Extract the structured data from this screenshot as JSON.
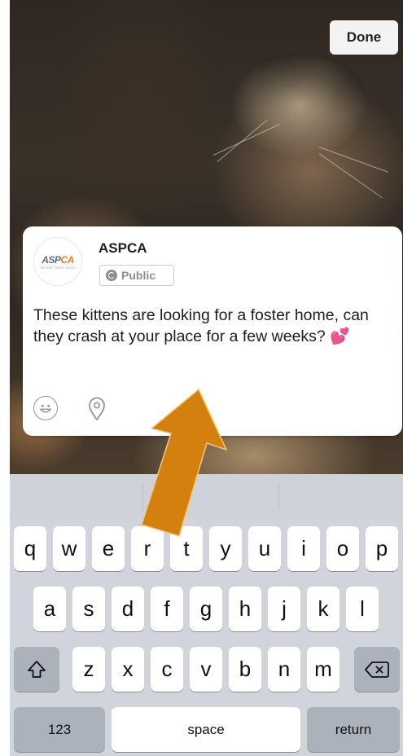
{
  "header": {
    "done_label": "Done"
  },
  "post": {
    "page_name": "ASPCA",
    "avatar_logo_a": "ASP",
    "avatar_logo_b": "CA",
    "avatar_tagline": "WE ARE THEIR VOICE",
    "privacy_label": "Public",
    "text": "These kittens are looking for a foster home, can they crash at your place for a few weeks?",
    "emoji": "💕",
    "tools": [
      "emoji-icon",
      "location-pin-icon"
    ]
  },
  "keyboard": {
    "row1": [
      "q",
      "w",
      "e",
      "r",
      "t",
      "y",
      "u",
      "i",
      "o",
      "p"
    ],
    "row2": [
      "a",
      "s",
      "d",
      "f",
      "g",
      "h",
      "j",
      "k",
      "l"
    ],
    "row3": [
      "z",
      "x",
      "c",
      "v",
      "b",
      "n",
      "m"
    ],
    "shift_icon": "shift-icon",
    "delete_icon": "backspace-icon",
    "numbers_label": "123",
    "space_label": "space",
    "return_label": "return"
  },
  "annotation": {
    "arrow_color": "#d4800f",
    "arrow_stroke": "#f3c77a"
  }
}
